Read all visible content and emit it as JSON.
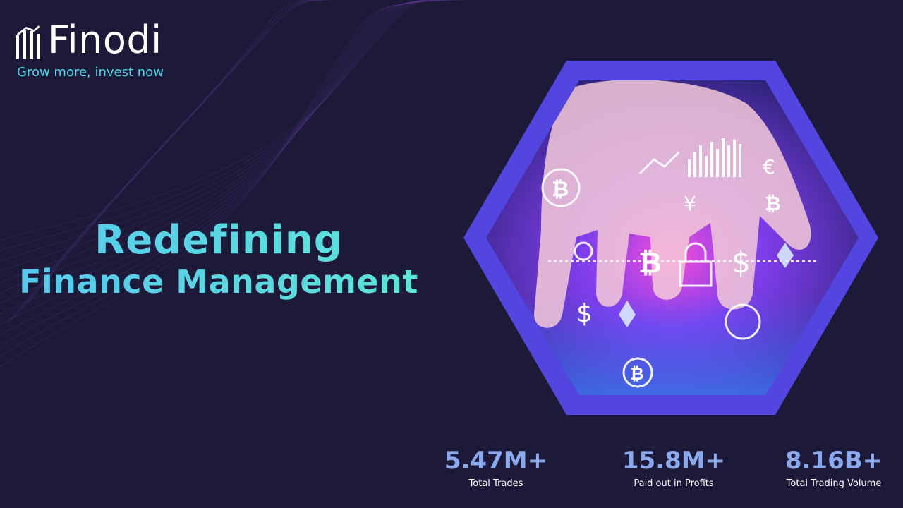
{
  "brand": {
    "name": "Finodi",
    "tagline": "Grow more, invest now"
  },
  "hero": {
    "line1": "Redefining",
    "line2": "Finance Management"
  },
  "stats": [
    {
      "value": "5.47M+",
      "label": "Total Trades"
    },
    {
      "value": "15.8M+",
      "label": "Paid out in Profits"
    },
    {
      "value": "8.16B+",
      "label": "Total Trading Volume"
    }
  ],
  "colors": {
    "background": "#1c1a38",
    "hex_frame": "#5346e0",
    "accent_cyan": "#49d6e8",
    "stat_value": "#8aa9ee"
  }
}
